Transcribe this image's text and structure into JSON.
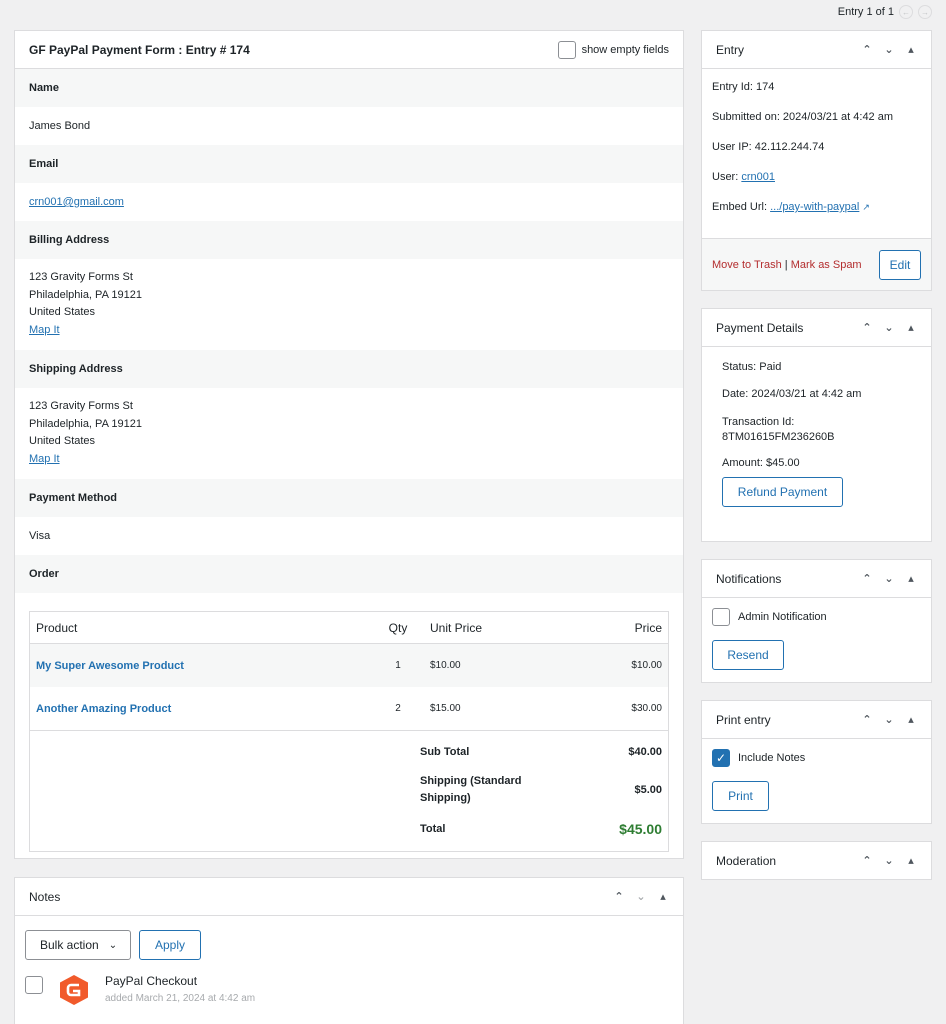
{
  "pager": {
    "text": "Entry 1 of 1",
    "prev_icon": "chevron-left-icon",
    "next_icon": "chevron-right-icon"
  },
  "entry": {
    "title": "GF PayPal Payment Form : Entry # 174",
    "show_empty_label": "show empty fields",
    "fields": {
      "name_label": "Name",
      "name_value": "James Bond",
      "email_label": "Email",
      "email_value": "crn001@gmail.com",
      "billing_label": "Billing Address",
      "billing_lines": [
        "123 Gravity Forms St",
        "Philadelphia, PA 19121",
        "United States"
      ],
      "billing_map": "Map It",
      "shipping_label": "Shipping Address",
      "shipping_lines": [
        "123 Gravity Forms St",
        "Philadelphia, PA 19121",
        "United States"
      ],
      "shipping_map": "Map It",
      "payment_label": "Payment Method",
      "payment_value": "Visa",
      "order_label": "Order"
    },
    "order": {
      "headers": {
        "product": "Product",
        "qty": "Qty",
        "unit": "Unit Price",
        "price": "Price"
      },
      "rows": [
        {
          "product": "My Super Awesome Product",
          "qty": "1",
          "unit": "$10.00",
          "price": "$10.00"
        },
        {
          "product": "Another Amazing Product",
          "qty": "2",
          "unit": "$15.00",
          "price": "$30.00"
        }
      ],
      "subtotal_label": "Sub Total",
      "subtotal": "$40.00",
      "shipping_label_1": "Shipping (Standard",
      "shipping_label_2": "Shipping)",
      "shipping": "$5.00",
      "total_label": "Total",
      "total": "$45.00"
    }
  },
  "notes": {
    "title": "Notes",
    "bulk_action": "Bulk action",
    "apply": "Apply",
    "note_author": "PayPal Checkout",
    "note_meta": "added March 21, 2024 at 4:42 am"
  },
  "sidebar": {
    "entry": {
      "title": "Entry",
      "id": "Entry Id: 174",
      "submitted": "Submitted on: 2024/03/21 at 4:42 am",
      "ip": "User IP: 42.112.244.74",
      "user_label": "User: ",
      "user_link": "crn001",
      "embed_label": "Embed Url: ",
      "embed_link": ".../pay-with-paypal",
      "trash": "Move to Trash",
      "sep": "|",
      "spam": "Mark as Spam",
      "edit": "Edit"
    },
    "payment": {
      "title": "Payment Details",
      "status": "Status: Paid",
      "date": "Date: 2024/03/21 at 4:42 am",
      "txn_label": "Transaction Id:",
      "txn_value": "8TM01615FM236260B",
      "amount": "Amount: $45.00",
      "refund": "Refund Payment"
    },
    "notifications": {
      "title": "Notifications",
      "admin": "Admin Notification",
      "resend": "Resend"
    },
    "print": {
      "title": "Print entry",
      "include_notes": "Include Notes",
      "print": "Print"
    },
    "moderation": {
      "title": "Moderation"
    }
  },
  "colors": {
    "accent": "#2271b1",
    "danger": "#b32d2e",
    "success": "#2e7d32",
    "gf_logo": "#f15a2b"
  }
}
